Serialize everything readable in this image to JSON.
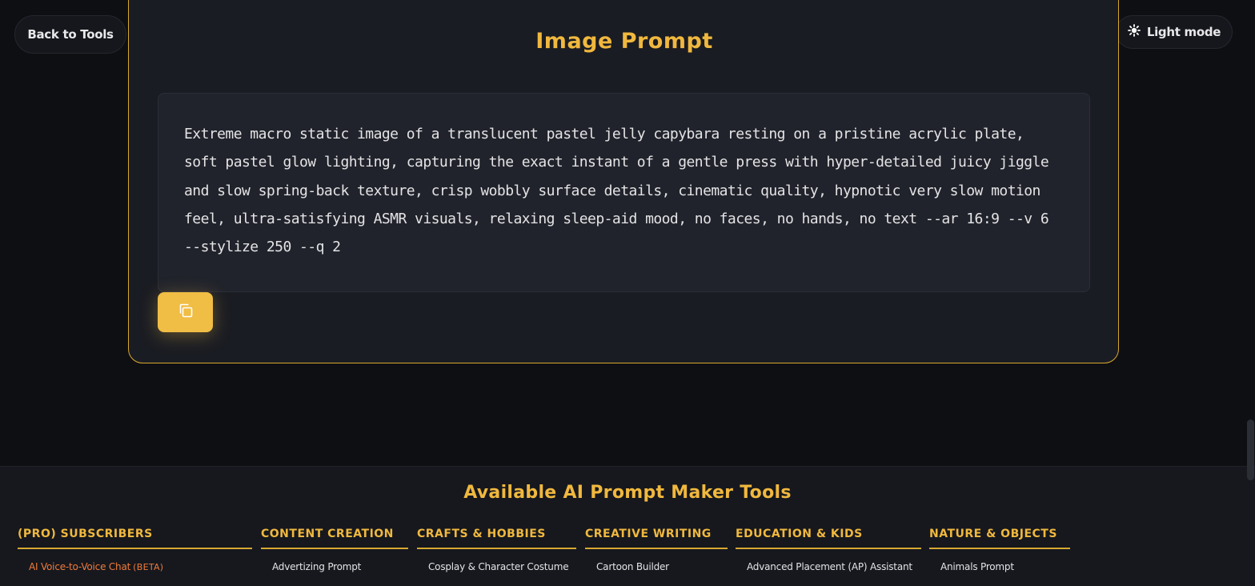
{
  "header": {
    "back_label": "Back to Tools",
    "light_mode_label": "Light mode"
  },
  "card": {
    "title": "Image Prompt",
    "prompt_text": "Extreme macro static image of a translucent pastel jelly capybara resting on a pristine acrylic plate, soft pastel glow lighting, capturing the exact instant of a gentle press with hyper-detailed juicy jiggle and slow spring-back texture, crisp wobbly surface details, cinematic quality, hypnotic very slow motion feel, ultra-satisfying ASMR visuals, relaxing sleep-aid mood, no faces, no hands, no text --ar 16:9 --v 6 --stylize 250 --q 2",
    "copy_icon": "copy-icon"
  },
  "footer": {
    "title": "Available AI Prompt Maker Tools",
    "categories": [
      {
        "header": "(PRO) SUBSCRIBERS",
        "item": "AI Voice-to-Voice Chat",
        "badge": "(BETA)"
      },
      {
        "header": "CONTENT CREATION",
        "item": "Advertizing Prompt"
      },
      {
        "header": "CRAFTS & HOBBIES",
        "item": "Cosplay & Character Costume"
      },
      {
        "header": "CREATIVE WRITING",
        "item": "Cartoon Builder"
      },
      {
        "header": "EDUCATION & KIDS",
        "item": "Advanced Placement (AP) Assistant"
      },
      {
        "header": "NATURE & OBJECTS",
        "item": "Animals Prompt"
      }
    ]
  },
  "colors": {
    "accent": "#f0b83e",
    "pro_item": "#f07a3a",
    "background": "#0e0f12",
    "card": "#1a1c23"
  }
}
